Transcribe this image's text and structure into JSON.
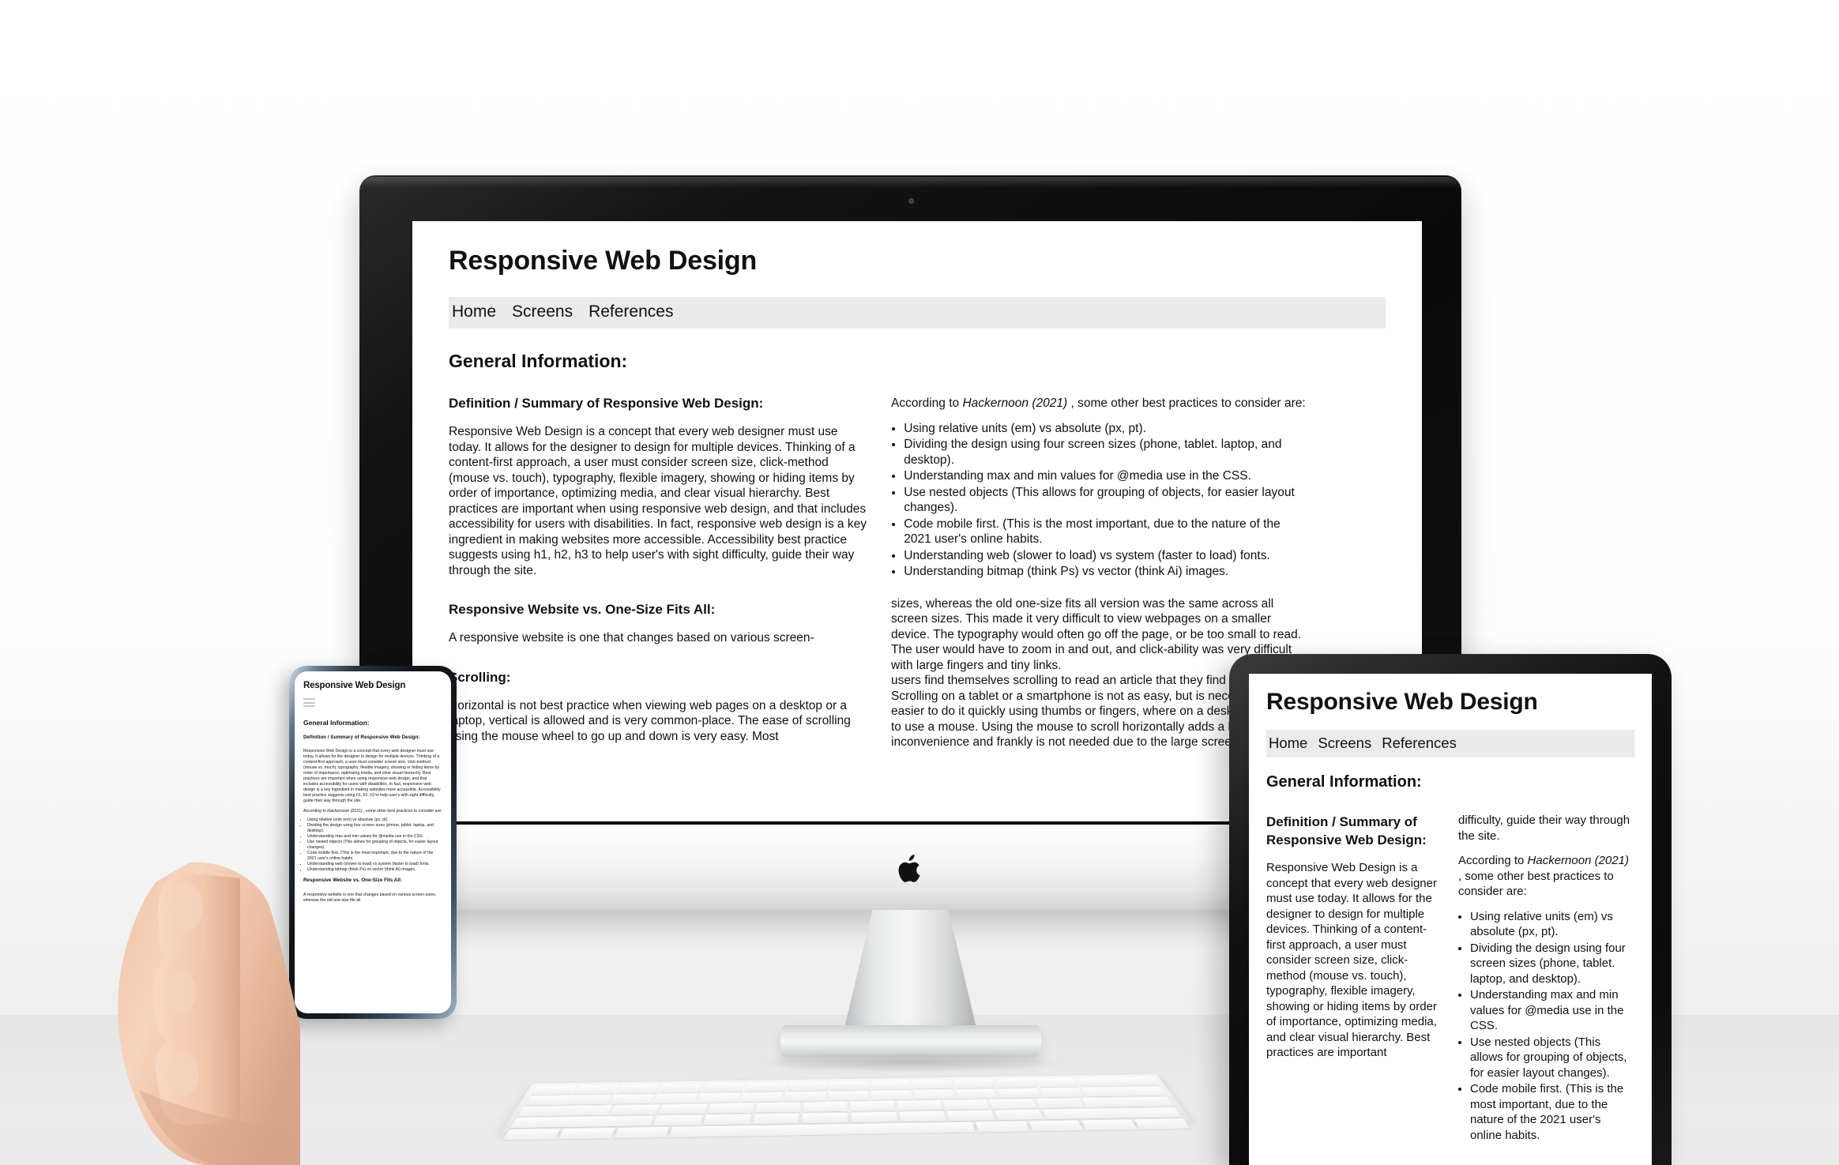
{
  "site": {
    "title": "Responsive Web Design",
    "nav": [
      "Home",
      "Screens",
      "References"
    ],
    "section_heading": "General Information:",
    "headings": {
      "definition": "Definition / Summary of Responsive Web Design:",
      "vs": "Responsive Website vs. One-Size Fits All:",
      "scrolling": "Scrolling:"
    },
    "paragraphs": {
      "definition": "Responsive Web Design is a concept that every web designer must use today. It allows for the designer to design for multiple devices. Thinking of a content-first approach, a user must consider screen size, click-method (mouse vs. touch), typography, flexible imagery, showing or hiding items by order of importance, optimizing media, and clear visual hierarchy. Best practices are important when using responsive web design, and that includes accessibility for users with disabilities. In fact, responsive web design is a key ingredient in making websites more accessible. Accessibility best practice suggests using h1, h2, h3 to help user's with sight difficulty, guide their way through the site.",
      "according_pre": "According to ",
      "according_cite": "Hackernoon (2021)",
      "according_post": " , some other best practices to consider are:",
      "vs_body": "A responsive website is one that changes based on various screen-",
      "vs_cont": "sizes, whereas the old one-size fits all version was the same across all screen sizes. This made it very difficult to view webpages on a smaller device. The typography would often go off the page, or be too small to read. The user would have to zoom in and out, and click-ability was very difficult with large fingers and tiny links.",
      "scrolling_body": "Horizontal is not best practice when viewing web pages on a desktop or a laptop, vertical is allowed and is very common-place. The ease of scrolling using the mouse wheel to go up and down is very easy. Most",
      "scrolling_cont": "users find themselves scrolling to read an article that they find interesting. Scrolling on a tablet or a smartphone is not as easy, but is necessary. It is easier to do it quickly using thumbs or fingers, where on a desktop you have to use a mouse. Using the mouse to scroll horizontally adds a level of inconvenience and frankly is not needed due to the large screen size.",
      "phone_vs_body": "A responsive website is one that changes based on various screen-sizes, whereas the old one-size fits all"
    },
    "best_practices": [
      "Using relative units (em) vs absolute (px, pt).",
      "Dividing the design using four screen sizes (phone, tablet. laptop, and desktop).",
      "Understanding max and min values for @media use in the CSS.",
      "Use nested objects (This allows for grouping of objects, for easier layout changes).",
      "Code mobile first. (This is the most important, due to the nature of the 2021 user's online habits.",
      "Understanding web (slower to load) vs system (faster to load) fonts.",
      "Understanding bitmap (think Ps) vs vector (think Ai) images."
    ],
    "tablet_right_first_line": "difficulty, guide their way through the site.",
    "tablet_definition_body": "Responsive Web Design is a concept that every web designer must use today. It allows for the designer to design for multiple devices. Thinking of a content-first approach, a user must consider screen size, click-method (mouse vs. touch), typography, flexible imagery, showing or hiding items by order of importance, optimizing media, and clear visual hierarchy. Best practices are important"
  },
  "devices": {
    "desktop_label": "imac-desktop",
    "tablet_label": "tablet",
    "phone_label": "smartphone",
    "keyboard_label": "apple-keyboard",
    "hand_label": "hand-holding-phone"
  },
  "icons": {
    "apple_logo": "apple-logo-icon",
    "hamburger": "hamburger-menu-icon",
    "camera": "webcam-icon"
  },
  "colors": {
    "background": "#fbfbfb",
    "page_background": "#ffffff",
    "nav_background": "#ebebeb",
    "text": "#111111",
    "bezel": "#0b0b0b"
  }
}
